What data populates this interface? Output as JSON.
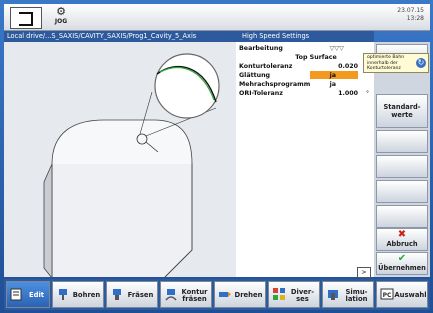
{
  "header": {
    "jog_label": "JOG",
    "date": "23.07.15",
    "time": "13:28"
  },
  "path": {
    "text": "Local drive/...S_SAXIS/CAVITY_SAXIS/Prog1_Cavity_5_Axis",
    "section_title": "High Speed Settings"
  },
  "params": {
    "bearbeitung_label": "Bearbeitung",
    "bearbeitung_value": "▽▽▽",
    "top_surface": "Top Surface",
    "konturtoleranz_label": "Konturtoleranz",
    "konturtoleranz_value": "0.020",
    "glaettung_label": "Glättung",
    "glaettung_value": "ja",
    "mehrachs_label": "Mehrachsprogramm",
    "mehrachs_value": "ja",
    "ori_label": "ORI-Toleranz",
    "ori_value": "1.000",
    "ori_unit": "°"
  },
  "hint": {
    "text": "optimierte Bahn innerhalb der Konturtoleranz"
  },
  "right_softkeys": {
    "standard": "Standard-werte",
    "abbruch": "Abbruch",
    "uebernehmen": "Übernehmen"
  },
  "bottom_softkeys": {
    "edit": "Edit",
    "bohren": "Bohren",
    "fraesen": "Fräsen",
    "kontur": "Kontur fräsen",
    "drehen": "Drehen",
    "diverses": "Diver-ses",
    "simulation": "Simu-lation",
    "auswahl": "Auswahl"
  },
  "scroll": {
    "arrow": ">"
  },
  "colors": {
    "accent": "#f39a1e",
    "title_bar": "#2c5a9c",
    "frame": "#3a78c8"
  }
}
